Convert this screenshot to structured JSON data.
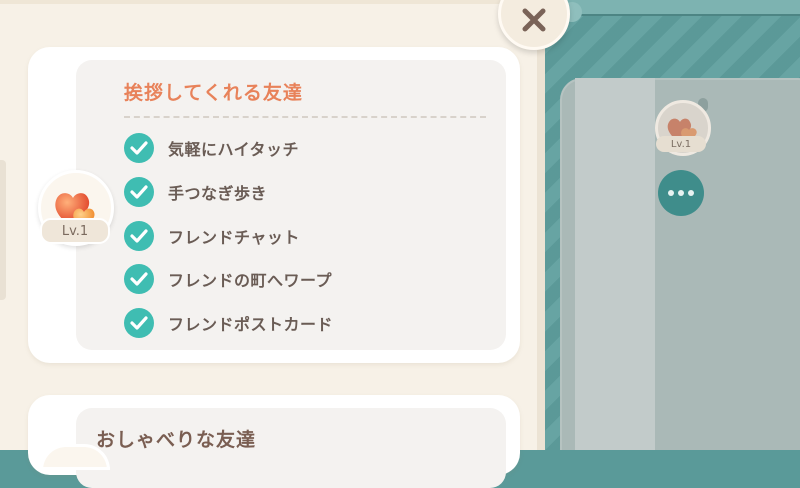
{
  "colors": {
    "title_accent": "#e8825a",
    "check_teal": "#3fbdb2",
    "text_brown": "#6a5c55",
    "panel_bg": "#f7f1e7",
    "scene_teal": "#5f9f9e"
  },
  "close_button": {
    "icon": "close-icon"
  },
  "friend_levels": [
    {
      "title": "挨拶してくれる友達",
      "level_label": "Lv.1",
      "avatar_icon": "hearts-icon",
      "perks": [
        {
          "label": "気軽にハイタッチ",
          "icon": "check-icon"
        },
        {
          "label": "手つなぎ歩き",
          "icon": "check-icon"
        },
        {
          "label": "フレンドチャット",
          "icon": "check-icon"
        },
        {
          "label": "フレンドの町へワープ",
          "icon": "check-icon"
        },
        {
          "label": "フレンドポストカード",
          "icon": "check-icon"
        }
      ]
    },
    {
      "title": "おしゃべりな友達"
    }
  ],
  "background_profile": {
    "level_label": "Lv.1",
    "avatar_icon": "hearts-icon",
    "more_icon": "more-icon"
  }
}
